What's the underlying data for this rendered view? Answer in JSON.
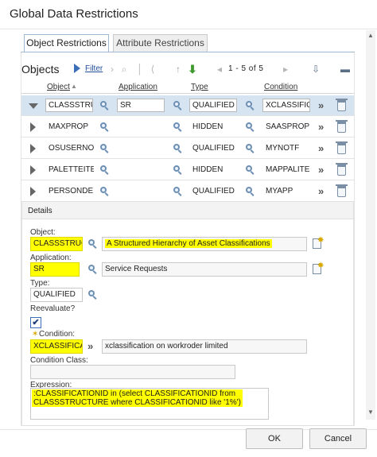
{
  "dialog": {
    "title": "Global Data Restrictions"
  },
  "tabs": [
    {
      "label": "Object Restrictions",
      "active": true
    },
    {
      "label": "Attribute Restrictions",
      "active": false
    }
  ],
  "objects_table": {
    "title": "Objects",
    "filter_label": "Filter",
    "paging_text": "1 - 5 of 5",
    "columns": [
      "Object",
      "Application",
      "Type",
      "Condition"
    ],
    "rows": [
      {
        "object": "CLASSSTRU",
        "application": "SR",
        "type": "QUALIFIED",
        "condition": "XCLASSIFIC/",
        "expanded": true
      },
      {
        "object": "MAXPROP",
        "application": "",
        "type": "HIDDEN",
        "condition": "SAASPROPS",
        "expanded": false
      },
      {
        "object": "OSUSERNO",
        "application": "",
        "type": "QUALIFIED",
        "condition": "MYNOTF",
        "expanded": false
      },
      {
        "object": "PALETTEITE",
        "application": "",
        "type": "HIDDEN",
        "condition": "MAPPALITEI",
        "expanded": false
      },
      {
        "object": "PERSONDEI",
        "application": "",
        "type": "QUALIFIED",
        "condition": "MYAPP",
        "expanded": false
      }
    ]
  },
  "details": {
    "title": "Details",
    "object_label": "Object:",
    "object_value": "CLASSSTRUC",
    "object_description": "A Structured Hierarchy of Asset Classifications",
    "application_label": "Application:",
    "application_value": "SR",
    "application_description": "Service Requests",
    "type_label": "Type:",
    "type_value": "QUALIFIED",
    "reevaluate_label": "Reevaluate?",
    "reevaluate_checked": true,
    "reevaluate_mark": "✔",
    "condition_label": "Condition:",
    "condition_value": "XCLASSIFICA",
    "condition_description": "xclassification on workroder limited",
    "condition_class_label": "Condition Class:",
    "condition_class_value": "",
    "expression_label": "Expression:",
    "expression_line1": ":CLASSIFICATIONID in (select CLASSIFICATIONID from",
    "expression_line2": "CLASSSTRUCTURE where CLASSIFICATIONID like '1%')"
  },
  "buttons": {
    "ok": "OK",
    "cancel": "Cancel"
  },
  "colors": {
    "highlight": "#ffff00",
    "selected_row": "#d6e4f2",
    "link": "#1f4f99",
    "tab_border": "#9fb8d3"
  },
  "icons": {
    "row_lookup": "magnifier-icon",
    "row_action": "double-chevron-icon",
    "row_delete": "trash-icon",
    "filter_toggle": "filter-arrow-icon",
    "download": "download-icon",
    "new_record": "new-record-icon"
  }
}
